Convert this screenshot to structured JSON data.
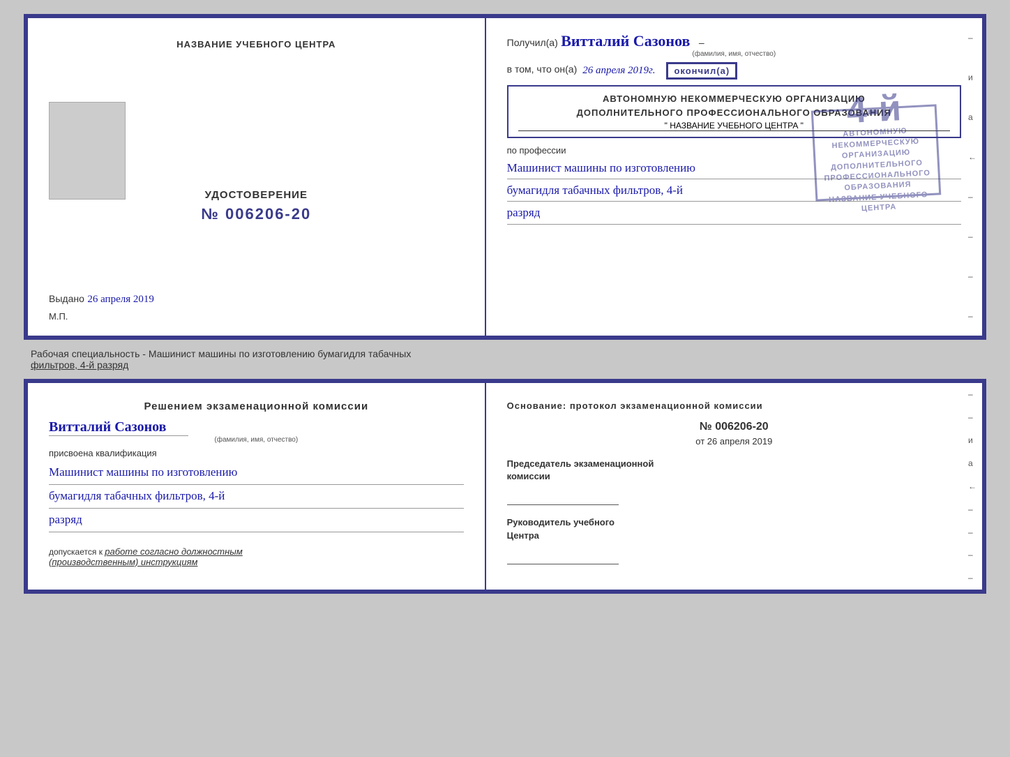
{
  "top_cert": {
    "left": {
      "school_name_label": "НАЗВАНИЕ УЧЕБНОГО ЦЕНТРА",
      "udostoverenie_label": "УДОСТОВЕРЕНИЕ",
      "cert_number": "№ 006206-20",
      "issued_label": "Выдано",
      "issued_date": "26 апреля 2019",
      "mp_label": "М.П."
    },
    "right": {
      "received_prefix": "Получил(а)",
      "received_name": "Витталий Сазонов",
      "received_subtitle": "(фамилия, имя, отчество)",
      "received_dash": "–",
      "vtom_prefix": "в том, что он(а)",
      "vtom_date": "26 апреля 2019г.",
      "okoncil_label": "окончил(а)",
      "org_line1": "АВТОНОМНУЮ НЕКОММЕРЧЕСКУЮ ОРГАНИЗАЦИЮ",
      "org_line2": "ДОПОЛНИТЕЛЬНОГО ПРОФЕССИОНАЛЬНОГО ОБРАЗОВАНИЯ",
      "org_name_placeholder": "\" НАЗВАНИЕ УЧЕБНОГО ЦЕНТРА \"",
      "po_professii_label": "по профессии",
      "profession_line1": "Машинист машины по изготовлению",
      "profession_line2": "бумагидля табачных фильтров, 4-й",
      "profession_line3": "разряд"
    }
  },
  "bottom_label": {
    "prefix": "Рабочая специальность - Машинист машины по изготовлению бумагидля табачных",
    "underlined": "фильтров, 4-й разряд"
  },
  "bottom_cert": {
    "left": {
      "reshenie_title": "Решением  экзаменационной  комиссии",
      "person_name": "Витталий Сазонов",
      "fio_subtitle": "(фамилия, имя, отчество)",
      "prisvoena_label": "присвоена квалификация",
      "qualification_line1": "Машинист машины по изготовлению",
      "qualification_line2": "бумагидля табачных фильтров, 4-й",
      "qualification_line3": "разряд",
      "dopuskaetsya_prefix": "допускается к",
      "dopuskaetsya_text": "работе согласно должностным",
      "dopuskaetsya_text2": "(производственным) инструкциям"
    },
    "right": {
      "osnovanie_title": "Основание: протокол экзаменационной  комиссии",
      "proto_number": "№  006206-20",
      "proto_date_prefix": "от",
      "proto_date": "26 апреля 2019",
      "predsedatel_title": "Председатель экзаменационной",
      "predsedatel_subtitle": "комиссии",
      "rukovoditel_title": "Руководитель учебного",
      "rukovoditel_subtitle": "Центра"
    }
  },
  "stamp": {
    "number": "4-й",
    "line1": "АВТОНОМНУЮ НЕКОММЕРЧЕСКУЮ ОРГАНИЗАЦИЮ",
    "line2": "ДОПОЛНИТЕЛЬНОГО ПРОФЕССИОНАЛЬНОГО ОБРАЗОВАНИЯ",
    "line3": "НАЗВАНИЕ УЧЕБНОГО ЦЕНТРА"
  },
  "side_marks": [
    "-",
    "–",
    "и",
    "а",
    "←",
    "–",
    "–",
    "–",
    "–",
    "–"
  ]
}
